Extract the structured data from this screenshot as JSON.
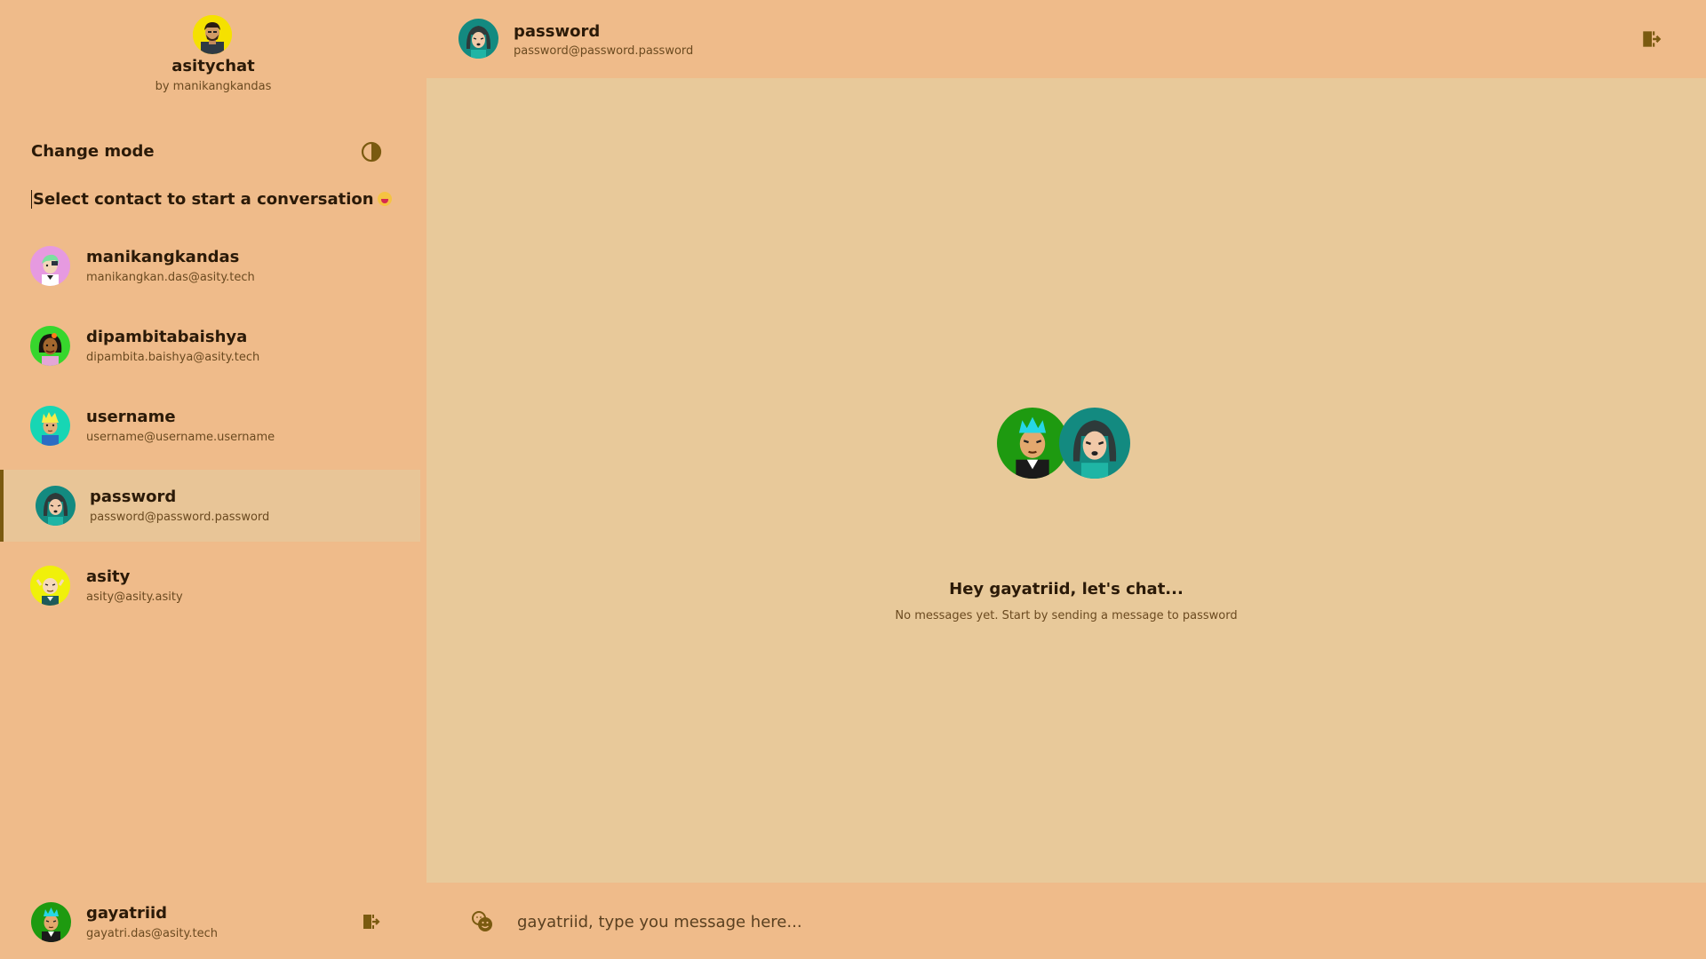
{
  "brand": {
    "title": "asitychat",
    "byline": "by manikangkandas"
  },
  "sidebar": {
    "mode_label": "Change mode",
    "mode_icon": "half-circle-contrast-icon",
    "prompt": "Select contact to start a conversation",
    "prompt_emoji": "tongue-out-face-emoji",
    "contacts": [
      {
        "name": "manikangkandas",
        "email": "manikangkan.das@asity.tech",
        "avatar_bg": "#e69ae0"
      },
      {
        "name": "dipambitabaishya",
        "email": "dipambita.baishya@asity.tech",
        "avatar_bg": "#37d62d"
      },
      {
        "name": "username",
        "email": "username@username.username",
        "avatar_bg": "#17d6b4"
      },
      {
        "name": "password",
        "email": "password@password.password",
        "avatar_bg": "#138a80",
        "active": true
      },
      {
        "name": "asity",
        "email": "asity@asity.asity",
        "avatar_bg": "#f0f00a"
      }
    ]
  },
  "current_user": {
    "name": "gayatriid",
    "email": "gayatri.das@asity.tech",
    "avatar_bg": "#1e9a10"
  },
  "chat": {
    "header": {
      "name": "password",
      "email": "password@password.password"
    },
    "empty_title": "Hey gayatriid, let's chat...",
    "empty_subtitle": "No messages yet. Start by sending a message to password"
  },
  "composer": {
    "placeholder": "gayatriid, type you message here...",
    "emoji_icon": "emoji-picker-icon"
  },
  "icons": {
    "logout": "logout-door-icon"
  },
  "colors": {
    "sidebar_bg": "#efbb8a",
    "chat_bg": "#e8c99a",
    "active_contact_bg": "#e8c597",
    "accent": "#7a5a10",
    "text": "#2b1a08"
  }
}
